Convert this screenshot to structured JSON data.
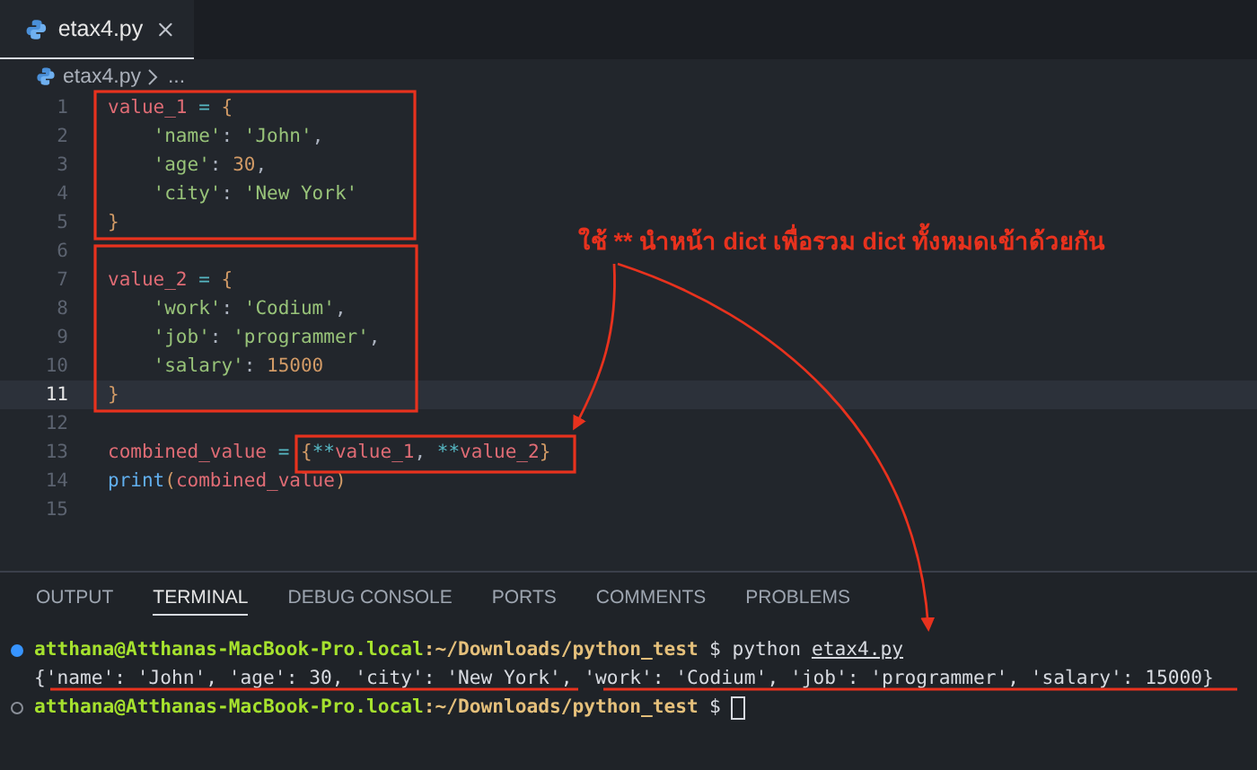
{
  "tabs": [
    {
      "label": "etax4.py",
      "selected": true
    }
  ],
  "breadcrumb": {
    "file": "etax4.py",
    "rest": "..."
  },
  "editor": {
    "lines": [
      {
        "number": "1",
        "current": false,
        "tokens": [
          {
            "text": "value_1",
            "kind": "var"
          },
          {
            "text": " = ",
            "kind": "op"
          },
          {
            "text": "{",
            "kind": "brace"
          }
        ]
      },
      {
        "number": "2",
        "current": false,
        "tokens": [
          {
            "text": "    'name'",
            "kind": "str"
          },
          {
            "text": ": ",
            "kind": "punct"
          },
          {
            "text": "'John'",
            "kind": "str"
          },
          {
            "text": ",",
            "kind": "punct"
          }
        ]
      },
      {
        "number": "3",
        "current": false,
        "tokens": [
          {
            "text": "    'age'",
            "kind": "str"
          },
          {
            "text": ": ",
            "kind": "punct"
          },
          {
            "text": "30",
            "kind": "num"
          },
          {
            "text": ",",
            "kind": "punct"
          }
        ]
      },
      {
        "number": "4",
        "current": false,
        "tokens": [
          {
            "text": "    'city'",
            "kind": "str"
          },
          {
            "text": ": ",
            "kind": "punct"
          },
          {
            "text": "'New York'",
            "kind": "str"
          }
        ]
      },
      {
        "number": "5",
        "current": false,
        "tokens": [
          {
            "text": "}",
            "kind": "brace"
          }
        ]
      },
      {
        "number": "6",
        "current": false
      },
      {
        "number": "7",
        "current": false,
        "tokens": [
          {
            "text": "value_2",
            "kind": "var"
          },
          {
            "text": " = ",
            "kind": "op"
          },
          {
            "text": "{",
            "kind": "brace"
          }
        ]
      },
      {
        "number": "8",
        "current": false,
        "tokens": [
          {
            "text": "    'work'",
            "kind": "str"
          },
          {
            "text": ": ",
            "kind": "punct"
          },
          {
            "text": "'Codium'",
            "kind": "str"
          },
          {
            "text": ",",
            "kind": "punct"
          }
        ]
      },
      {
        "number": "9",
        "current": false,
        "tokens": [
          {
            "text": "    'job'",
            "kind": "str"
          },
          {
            "text": ": ",
            "kind": "punct"
          },
          {
            "text": "'programmer'",
            "kind": "str"
          },
          {
            "text": ",",
            "kind": "punct"
          }
        ]
      },
      {
        "number": "10",
        "current": false,
        "tokens": [
          {
            "text": "    'salary'",
            "kind": "str"
          },
          {
            "text": ": ",
            "kind": "punct"
          },
          {
            "text": "15000",
            "kind": "num"
          }
        ]
      },
      {
        "number": "11",
        "current": true,
        "tokens": [
          {
            "text": "}",
            "kind": "brace"
          }
        ]
      },
      {
        "number": "12",
        "current": false
      },
      {
        "number": "13",
        "current": false,
        "tokens": [
          {
            "text": "combined_value",
            "kind": "var"
          },
          {
            "text": " = ",
            "kind": "op"
          },
          {
            "text": "{",
            "kind": "brace"
          },
          {
            "text": "**",
            "kind": "spread"
          },
          {
            "text": "value_1",
            "kind": "var"
          },
          {
            "text": ", ",
            "kind": "punct"
          },
          {
            "text": "**",
            "kind": "spread"
          },
          {
            "text": "value_2",
            "kind": "var"
          },
          {
            "text": "}",
            "kind": "brace"
          }
        ]
      },
      {
        "number": "14",
        "current": false,
        "tokens": [
          {
            "text": "print",
            "kind": "func"
          },
          {
            "text": "(",
            "kind": "brace"
          },
          {
            "text": "combined_value",
            "kind": "var"
          },
          {
            "text": ")",
            "kind": "brace"
          }
        ]
      },
      {
        "number": "15",
        "current": false
      }
    ]
  },
  "panel": {
    "tabs": [
      {
        "label": "OUTPUT",
        "selected": false
      },
      {
        "label": "TERMINAL",
        "selected": true
      },
      {
        "label": "DEBUG CONSOLE",
        "selected": false
      },
      {
        "label": "PORTS",
        "selected": false
      },
      {
        "label": "COMMENTS",
        "selected": false
      },
      {
        "label": "PROBLEMS",
        "selected": false
      }
    ],
    "terminal": [
      {
        "kind": "prompt",
        "dot_filled": true,
        "user": "atthana@Atthanas-MacBook-Pro.local",
        "path": ":~/Downloads/python_test",
        "command": "$ python",
        "argument": "etax4.py"
      },
      {
        "kind": "output",
        "text": "{'name': 'John', 'age': 30, 'city': 'New York', 'work': 'Codium', 'job': 'programmer', 'salary': 15000}"
      },
      {
        "kind": "prompt",
        "dot_filled": false,
        "user": "atthana@Atthanas-MacBook-Pro.local",
        "path": ":~/Downloads/python_test",
        "command": "$"
      }
    ]
  },
  "annotation": {
    "callout": "ใช้ ** นำหน้า dict เพื่อรวม dict ทั้งหมดเข้าด้วยกัน"
  }
}
